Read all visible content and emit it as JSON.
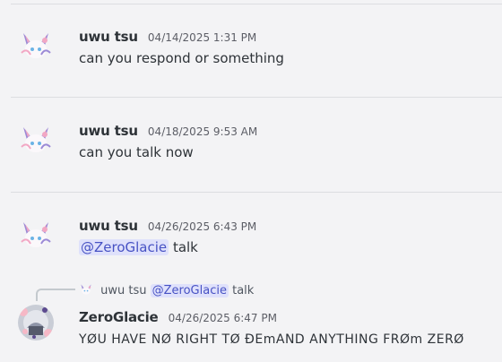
{
  "messages": [
    {
      "author": "uwu tsu",
      "timestamp": "04/14/2025 1:31 PM",
      "text": "can you respond or something"
    },
    {
      "author": "uwu tsu",
      "timestamp": "04/18/2025 9:53 AM",
      "text": "can you talk now"
    },
    {
      "author": "uwu tsu",
      "timestamp": "04/26/2025 6:43 PM",
      "mention": "@ZeroGlacie",
      "text": "talk"
    }
  ],
  "reply": {
    "ref_author": "uwu tsu",
    "ref_mention": "@ZeroGlacie",
    "ref_text": "talk",
    "author": "ZeroGlacie",
    "timestamp": "04/26/2025 6:47 PM",
    "text": "YØU HAVE NØ RIGHT TØ ÐEmAND ANYTHING FRØm ZERØ"
  },
  "colors": {
    "background": "#f3f3f5",
    "mention_bg": "#dfe1fb",
    "mention_text": "#4752c4",
    "divider": "#dcdde1"
  },
  "icons": [
    "sylveon-avatar-icon",
    "zeroglacie-avatar-icon"
  ]
}
